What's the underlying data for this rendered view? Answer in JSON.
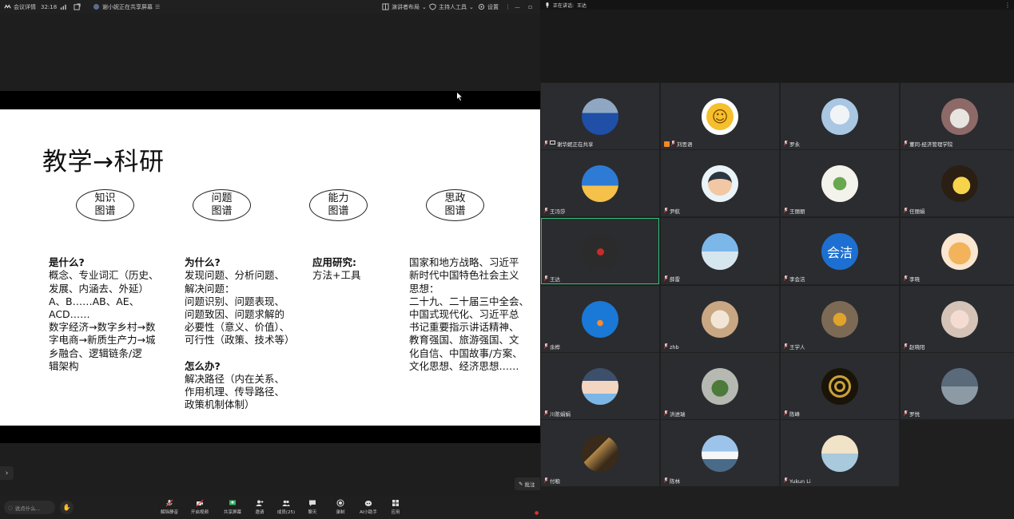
{
  "meeting": {
    "topbar": {
      "meeting_info": "会议详情",
      "timer": "32:18",
      "sharing_status": "谢小妮正在共享屏幕",
      "layout_button": "演讲者布局",
      "host_button": "主持人工具",
      "settings_button": "设置"
    },
    "slide": {
      "title": "教学→科研",
      "ellipses": [
        "知识\n图谱",
        "问题\n图谱",
        "能力\n图谱",
        "思政\n图谱"
      ],
      "columns": [
        {
          "heading": "是什么?",
          "body": "概念、专业词汇（历史、\n发展、内涵去、外延）\nA、B……AB、AE、\nACD……\n数字经济→数字乡村→数\n字电商→新质生产力→城\n乡融合、逻辑链条/逻\n辑架构"
        },
        {
          "heading": "为什么?",
          "body": "发现问题、分析问题、\n解决问题：\n问题识别、问题表现、\n问题致因、问题求解的\n必要性（意义、价值）、\n可行性（政策、技术等）",
          "heading2": "怎么办?",
          "body2": "解决路径（内在关系、\n作用机理、传导路径、\n政策机制体制）"
        },
        {
          "heading": "应用研究:",
          "body": "方法+工具"
        },
        {
          "heading": "",
          "body": "国家和地方战略、习近平\n新时代中国特色社会主义\n思想：\n二十九、二十届三中全会、\n中国式现代化、习近平总\n书记重要指示讲话精神、\n教育强国、旅游强国、文\n化自信、中国故事/方案、\n文化思想、经济思想……"
        }
      ]
    },
    "chat_placeholder": "说点什么...",
    "annotate_label": "批注",
    "toolbar": [
      {
        "label": "解除静音",
        "icon": "mic-muted-icon"
      },
      {
        "label": "开启视频",
        "icon": "video-off-icon"
      },
      {
        "label": "共享屏幕",
        "icon": "share-screen-icon"
      },
      {
        "label": "邀请",
        "icon": "invite-icon"
      },
      {
        "label": "成员(25)",
        "icon": "members-icon"
      },
      {
        "label": "聊天",
        "icon": "chat-icon"
      },
      {
        "label": "录制",
        "icon": "record-icon"
      },
      {
        "label": "AI小助手",
        "icon": "ai-assistant-icon"
      },
      {
        "label": "应用",
        "icon": "apps-icon"
      }
    ]
  },
  "gallery": {
    "speaking_label": "正在讲话:",
    "speaking_name": "王达",
    "participants": [
      {
        "name": "谢华妮正在共享",
        "avatar": "photo-person-blue"
      },
      {
        "name": "刘思语",
        "avatar": "smiley-emoji"
      },
      {
        "name": "罗永",
        "avatar": "photo-white-bird"
      },
      {
        "name": "董同-经济管理学院",
        "avatar": "photo-dog"
      },
      {
        "name": "王冯莎",
        "avatar": "cartoon-sea"
      },
      {
        "name": "尹航",
        "avatar": "cartoon-boy-glasses"
      },
      {
        "name": "王丽丽",
        "avatar": "photo-green-lizard"
      },
      {
        "name": "任丽娟",
        "avatar": "cartoon-pikachu"
      },
      {
        "name": "王达",
        "avatar": "dark-red-dot"
      },
      {
        "name": "薛雷",
        "avatar": "photo-beach"
      },
      {
        "name": "李会洁",
        "avatar": "text-avatar",
        "initials": "会洁"
      },
      {
        "name": "李晓",
        "avatar": "cartoon-tiger"
      },
      {
        "name": "余桦",
        "avatar": "photo-blue-sky"
      },
      {
        "name": "zhb",
        "avatar": "photo-cat"
      },
      {
        "name": "王学人",
        "avatar": "photo-figurine"
      },
      {
        "name": "赵晓阳",
        "avatar": "photo-baby"
      },
      {
        "name": "川陈娟娟",
        "avatar": "cartoon-anime-boy"
      },
      {
        "name": "洪进瑞",
        "avatar": "photo-plant"
      },
      {
        "name": "陈峰",
        "avatar": "logo-gold"
      },
      {
        "name": "罗悦",
        "avatar": "photo-bridge"
      },
      {
        "name": "付粮",
        "avatar": "photo-car"
      },
      {
        "name": "陈林",
        "avatar": "photo-mountain"
      },
      {
        "name": "Yukun Li",
        "avatar": "photo-lake"
      }
    ]
  },
  "colors": {
    "active_border": "#36c07b",
    "avatar_blue": "#1d6fd1"
  }
}
